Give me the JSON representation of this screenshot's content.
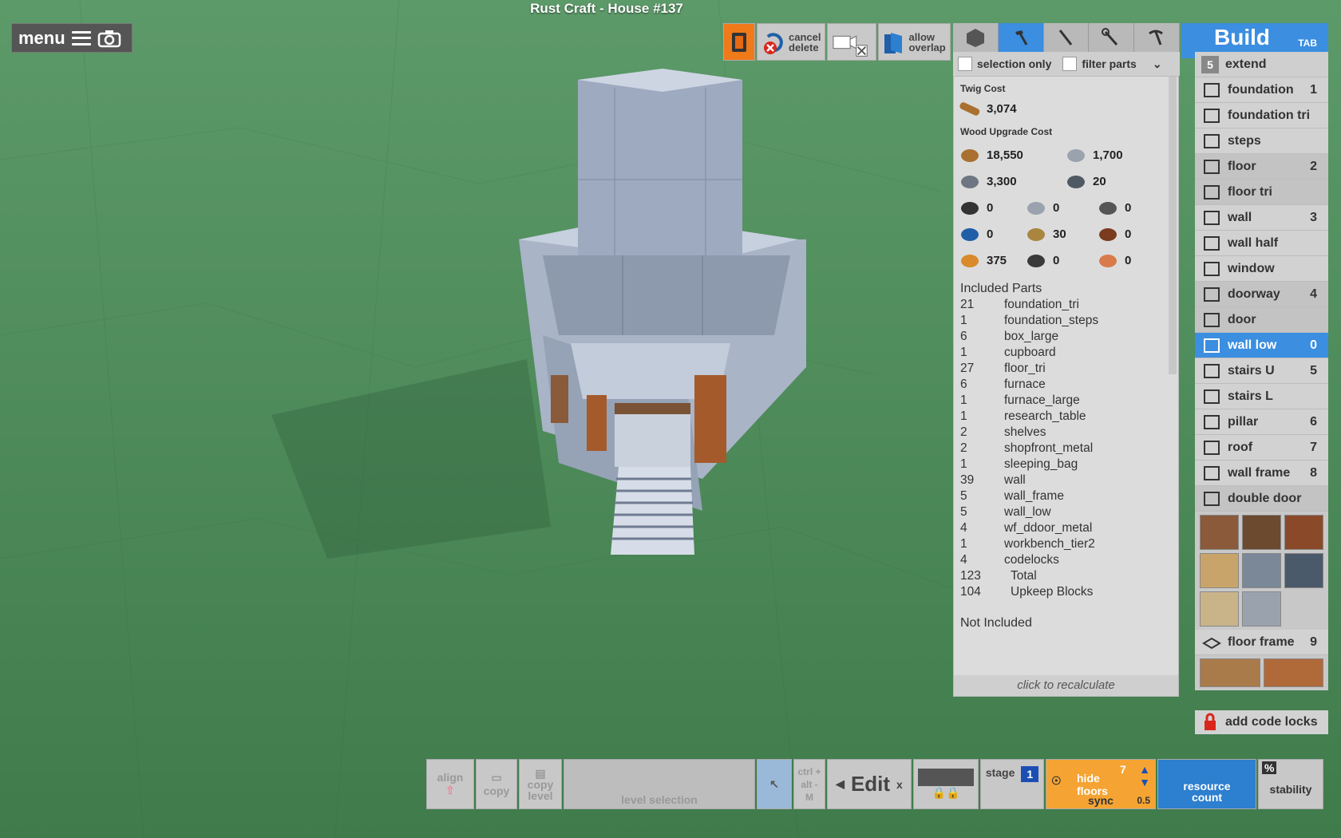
{
  "window": {
    "title": "Rust Craft - House #137"
  },
  "menu": {
    "label": "menu"
  },
  "toolbar": {
    "cancel_delete": [
      "cancel",
      "delete"
    ],
    "allow_overlap": [
      "allow",
      "overlap"
    ]
  },
  "filters": {
    "selection_only": "selection only",
    "filter_parts": "filter parts"
  },
  "cost": {
    "twig_label": "Twig Cost",
    "twig_value": "3,074",
    "wood_label": "Wood Upgrade Cost",
    "wood": [
      {
        "icon": "wood-icon",
        "value": "18,550"
      },
      {
        "icon": "stone-icon",
        "value": "1,700"
      },
      {
        "icon": "metal-fragments-icon",
        "value": "3,300"
      },
      {
        "icon": "hq-metal-icon",
        "value": "20"
      },
      {
        "icon": "gear-icon",
        "value": "0"
      },
      {
        "icon": "blade-icon",
        "value": "0"
      },
      {
        "icon": "rope-icon",
        "value": "0"
      },
      {
        "icon": "tarp-icon",
        "value": "0"
      },
      {
        "icon": "cloth-icon",
        "value": "30"
      },
      {
        "icon": "pipe-icon",
        "value": "0"
      },
      {
        "icon": "lowgrade-fuel-icon",
        "value": "375"
      },
      {
        "icon": "spring-icon",
        "value": "0"
      },
      {
        "icon": "leather-icon",
        "value": "0"
      }
    ],
    "included_label": "Included Parts",
    "parts": [
      [
        "21",
        "foundation_tri"
      ],
      [
        "1",
        "foundation_steps"
      ],
      [
        "6",
        "box_large"
      ],
      [
        "1",
        "cupboard"
      ],
      [
        "27",
        "floor_tri"
      ],
      [
        "6",
        "furnace"
      ],
      [
        "1",
        "furnace_large"
      ],
      [
        "1",
        "research_table"
      ],
      [
        "2",
        "shelves"
      ],
      [
        "2",
        "shopfront_metal"
      ],
      [
        "1",
        "sleeping_bag"
      ],
      [
        "39",
        "wall"
      ],
      [
        "5",
        "wall_frame"
      ],
      [
        "5",
        "wall_low"
      ],
      [
        "4",
        "wf_ddoor_metal"
      ],
      [
        "1",
        "workbench_tier2"
      ],
      [
        "4",
        "codelocks"
      ],
      [
        "123",
        "Total"
      ],
      [
        "104",
        "Upkeep Blocks"
      ]
    ],
    "not_included_label": "Not Included",
    "recalculate_label": "click to recalculate"
  },
  "build": {
    "title": "Build",
    "tab_hint": "TAB",
    "extend": {
      "num": "5",
      "label": "extend"
    },
    "items": [
      {
        "label": "foundation",
        "num": "1",
        "icon": "foundation-icon"
      },
      {
        "label": "foundation tri",
        "num": "",
        "icon": "foundation-tri-icon"
      },
      {
        "label": "steps",
        "num": "",
        "icon": "steps-icon"
      },
      {
        "label": "floor",
        "num": "2",
        "icon": "floor-icon"
      },
      {
        "label": "floor tri",
        "num": "",
        "icon": "floor-tri-icon"
      },
      {
        "label": "wall",
        "num": "3",
        "icon": "wall-icon"
      },
      {
        "label": "wall half",
        "num": "",
        "icon": "wall-half-icon"
      },
      {
        "label": "window",
        "num": "",
        "icon": "window-icon"
      },
      {
        "label": "doorway",
        "num": "4",
        "icon": "doorway-icon"
      },
      {
        "label": "door",
        "num": "",
        "icon": "door-icon"
      },
      {
        "label": "wall low",
        "num": "0",
        "icon": "wall-low-icon"
      },
      {
        "label": "stairs U",
        "num": "5",
        "icon": "stairs-u-icon"
      },
      {
        "label": "stairs L",
        "num": "",
        "icon": "stairs-l-icon"
      },
      {
        "label": "pillar",
        "num": "6",
        "icon": "pillar-icon"
      },
      {
        "label": "roof",
        "num": "7",
        "icon": "roof-icon"
      },
      {
        "label": "wall frame",
        "num": "8",
        "icon": "wall-frame-icon"
      },
      {
        "label": "double door",
        "num": "",
        "icon": "double-door-icon"
      }
    ],
    "floor_frame": {
      "label": "floor frame",
      "num": "9"
    },
    "code_locks": "add code locks"
  },
  "bottom": {
    "align": "align",
    "copy": "copy",
    "copy_level": [
      "copy",
      "level"
    ],
    "level_selection": "level selection",
    "ctrl": "ctrl +",
    "alt": "alt -",
    "m": "M",
    "edit": "Edit",
    "close": "x",
    "stage_label": "stage",
    "stage_value": "1",
    "hide_floors": [
      "hide",
      "floors"
    ],
    "floors_count": "7",
    "sync": "sync",
    "sync_value": "0.5",
    "resource_count": [
      "resource",
      "count"
    ],
    "percent": "%",
    "stability": "stability"
  }
}
